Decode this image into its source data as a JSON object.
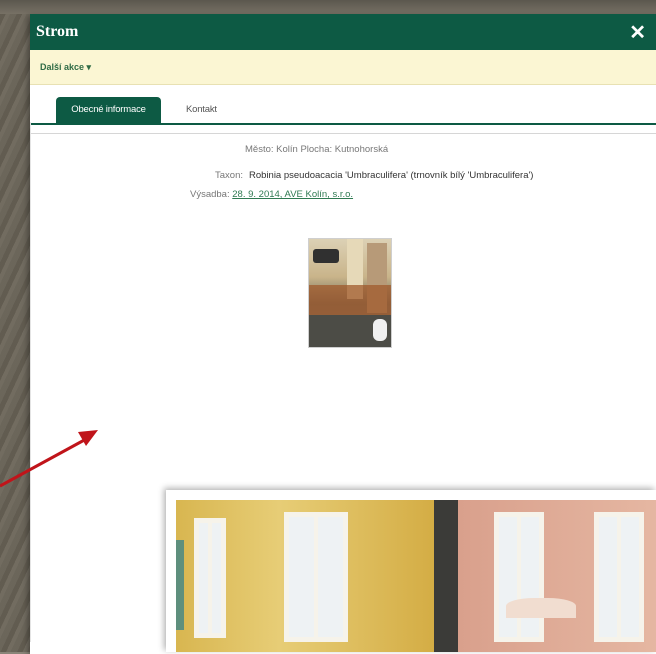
{
  "dialog": {
    "title": "Strom",
    "close_symbol": "✕",
    "actions_label": "Další akce ▾",
    "tabs": [
      {
        "label": "Obecné informace",
        "active": true
      },
      {
        "label": "Kontakt",
        "active": false
      }
    ],
    "location_text": "Město: Kolín Plocha: Kutnohorská",
    "taxon_label": "Taxon:",
    "taxon_value": "Robinia pseudoacacia 'Umbraculifera' (trnovník bílý 'Umbraculifera')",
    "planting_label": "Výsadba:",
    "planting_link": "28. 9. 2014, AVE Kolín, s.r.o."
  },
  "colors": {
    "header_green": "#0d5a44",
    "actionbar_yellow": "#fbf6d3",
    "link_green": "#2f7a52",
    "arrow_red": "#c0141a"
  },
  "icons": {
    "close": "close-icon",
    "dropdown": "chevron-down-icon",
    "arrow": "red-arrow-icon"
  }
}
